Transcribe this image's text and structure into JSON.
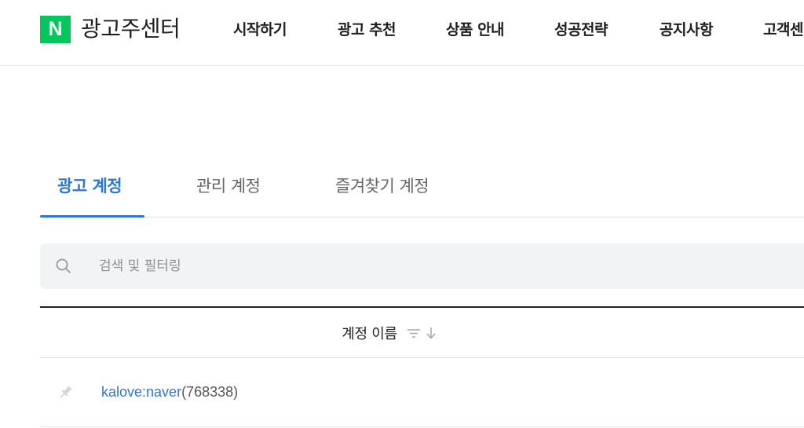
{
  "header": {
    "logo_text": "N",
    "title": "광고주센터",
    "nav": [
      "시작하기",
      "광고 추천",
      "상품 안내",
      "성공전략",
      "공지사항",
      "고객센터"
    ]
  },
  "tabs": [
    {
      "label": "광고 계정",
      "active": true
    },
    {
      "label": "관리 계정",
      "active": false
    },
    {
      "label": "즐겨찾기 계정",
      "active": false
    }
  ],
  "search": {
    "placeholder": "검색 및 필터링",
    "value": "",
    "icon": "search-icon"
  },
  "table": {
    "columns": [
      "계정 이름"
    ],
    "sort_icons": [
      "filter-icon",
      "arrow-down-icon"
    ],
    "rows": [
      {
        "name": "kalove:naver",
        "id": "(768338)",
        "pin_icon": "pin-icon",
        "pinned": false
      }
    ]
  },
  "colors": {
    "brand_green": "#03c75a",
    "accent_blue": "#2f76d2",
    "search_bg": "#f2f3f5"
  }
}
